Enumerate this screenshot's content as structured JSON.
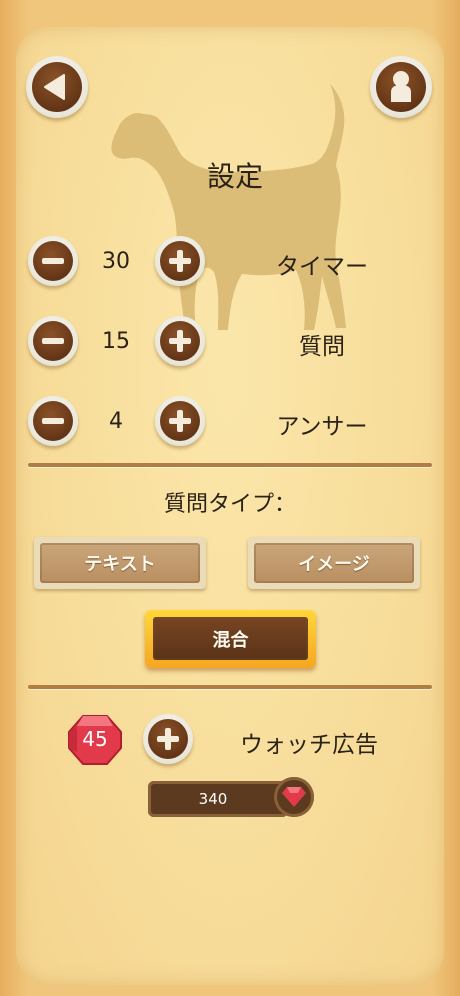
{
  "title": "設定",
  "settings": [
    {
      "value": "30",
      "label": "タイマー"
    },
    {
      "value": "15",
      "label": "質問"
    },
    {
      "value": "4",
      "label": "アンサー"
    }
  ],
  "question_type": {
    "heading": "質問タイプ：",
    "options": [
      "テキスト",
      "イメージ",
      "混合"
    ],
    "selected": "混合"
  },
  "ads": {
    "gem_count": "45",
    "label": "ウォッチ広告",
    "reward_amount": "340"
  },
  "icons": {
    "back": "back-arrow-icon",
    "profile": "profile-icon",
    "decrease": "minus-icon",
    "increase": "plus-icon",
    "gem": "ruby-gem-icon",
    "background": "dog-silhouette"
  },
  "colors": {
    "wood_dark": "#6a3a19",
    "panel": "#f8df9e",
    "selected_border": "#f5a623",
    "gem": "#e23a4a"
  }
}
